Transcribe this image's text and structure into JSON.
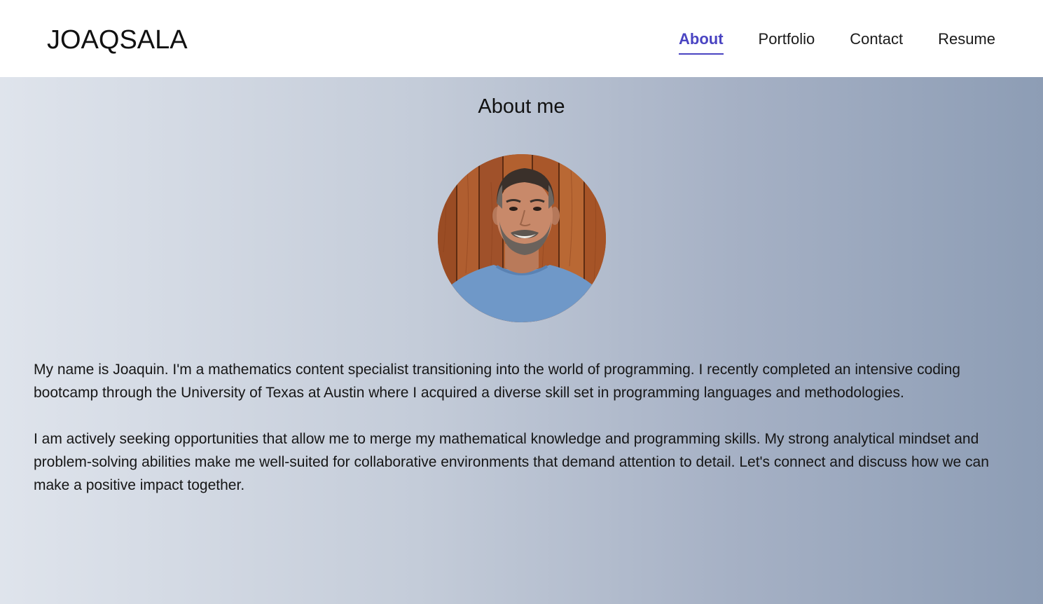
{
  "header": {
    "brand": "JOAQSALA",
    "nav": [
      {
        "label": "About",
        "active": true
      },
      {
        "label": "Portfolio",
        "active": false
      },
      {
        "label": "Contact",
        "active": false
      },
      {
        "label": "Resume",
        "active": false
      }
    ]
  },
  "about": {
    "title": "About me",
    "paragraphs": [
      "My name is Joaquin. I'm a mathematics content specialist transitioning into the world of programming. I recently completed an intensive coding bootcamp through the University of Texas at Austin where I acquired a diverse skill set in programming languages and methodologies.",
      "I am actively seeking opportunities that allow me to merge my mathematical knowledge and programming skills. My strong analytical mindset and problem-solving abilities make me well-suited for collaborative environments that demand attention to detail. Let's connect and discuss how we can make a positive impact together."
    ]
  },
  "colors": {
    "accent": "#4a44c2",
    "text": "#111111",
    "gradient_start": "#dfe4ec",
    "gradient_end": "#8d9db5"
  }
}
